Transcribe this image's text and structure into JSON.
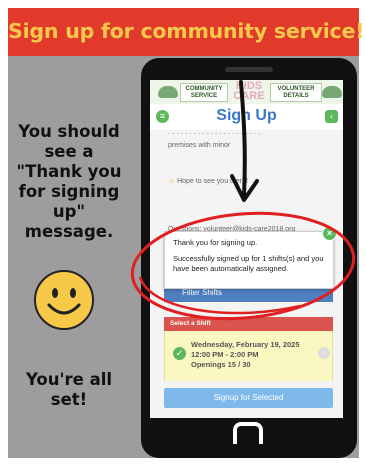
{
  "banner": {
    "title": "Sign up for community service!"
  },
  "instructions": {
    "top_lines": [
      "You should",
      "see a",
      "\"Thank you",
      "for signing",
      "up\"",
      "message."
    ],
    "bottom_lines": [
      "You're all",
      "set!"
    ]
  },
  "app": {
    "header": {
      "left_label": "COMMUNITY SERVICE",
      "logo": "KIDS CARE",
      "right_label": "VOLUNTEER DETAILS"
    },
    "page_title": "Sign Up",
    "content": {
      "line1": "- - - - - - - - - - - - - - - - - - - - - -",
      "line2": "premises with minor",
      "line3": "Hope to see you there!",
      "line4": "Questions: volunteer@kids-care2018.org"
    },
    "filter_label": "Filter Shifts",
    "shift_header": "Select a Shift",
    "shift": {
      "date": "Wednesday, February 19, 2025",
      "time": "12:00 PM - 2:00 PM",
      "openings": "Openings   15 / 30"
    },
    "signup_button": "Signup for Selected"
  },
  "toast": {
    "line1": "Thank you for signing up.",
    "line2": "Successfully signed up for 1 shifts(s) and you have been automatically assigned."
  },
  "colors": {
    "banner_bg": "#e23a2a",
    "banner_text": "#f7c94b",
    "panel_bg": "#9d9d9d",
    "accent_green": "#5cb85c",
    "title_blue": "#3a79c9",
    "annotation_red": "#e02020"
  }
}
